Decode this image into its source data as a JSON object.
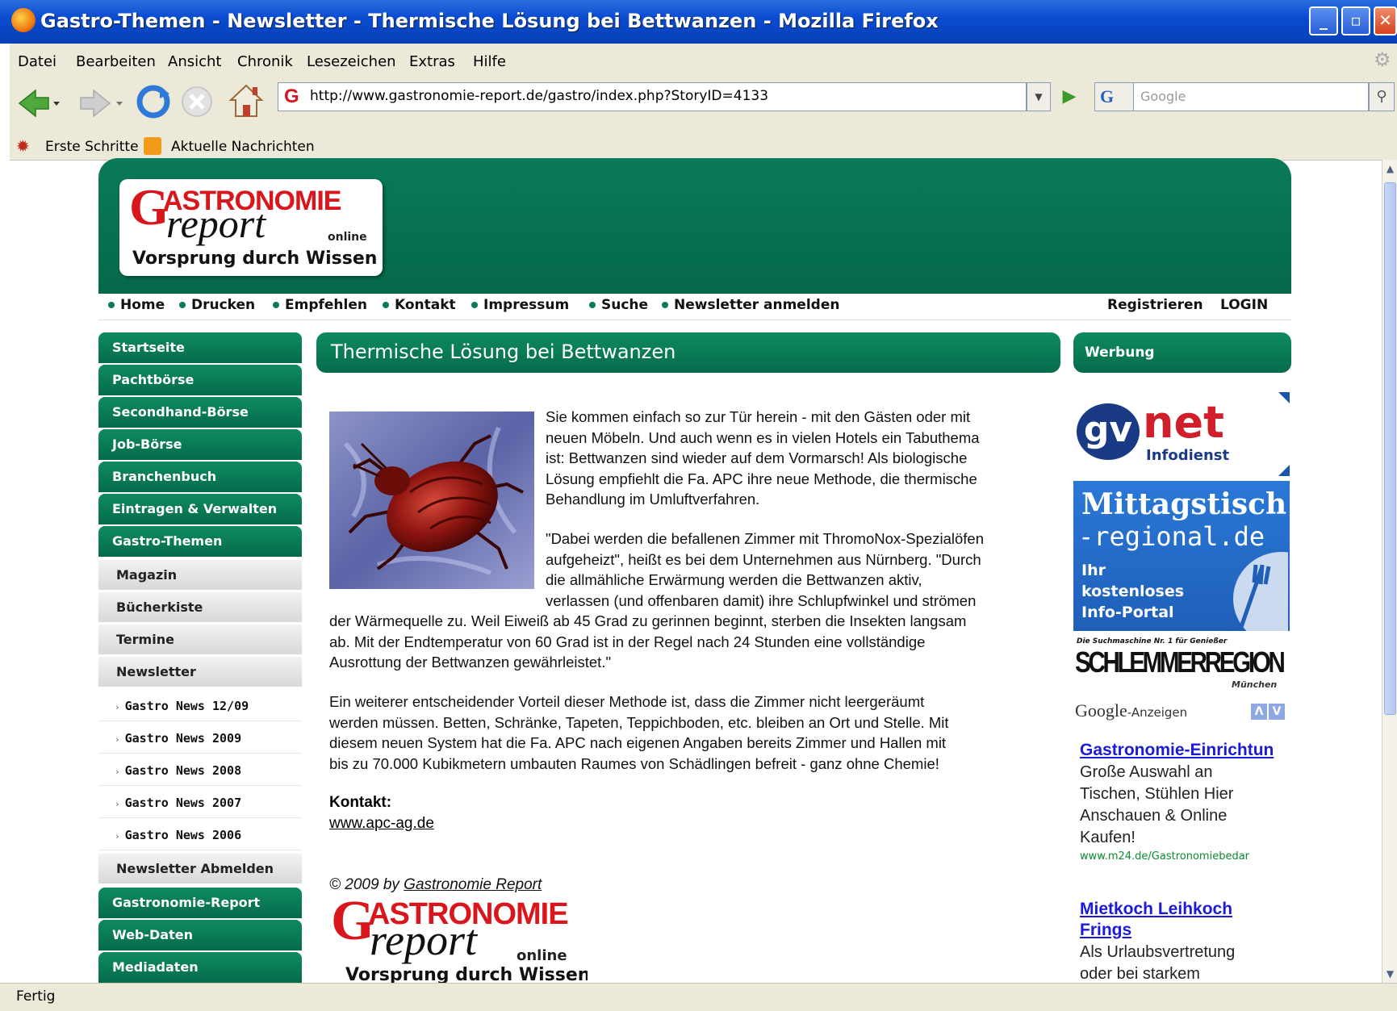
{
  "window": {
    "title": "Gastro-Themen - Newsletter - Thermische Lösung bei Bettwanzen - Mozilla Firefox",
    "buttons": {
      "minimize": "_",
      "maximize": "▫",
      "close": "✕"
    }
  },
  "menu": [
    "Datei",
    "Bearbeiten",
    "Ansicht",
    "Chronik",
    "Lesezeichen",
    "Extras",
    "Hilfe"
  ],
  "toolbar": {
    "url": "http://www.gastronomie-report.de/gastro/index.php?StoryID=4133",
    "search_placeholder": "Google"
  },
  "bookmarks": [
    "Erste Schritte",
    "Aktuelle Nachrichten"
  ],
  "status": "Fertig",
  "site": {
    "logo": {
      "initial": "G",
      "line1": "ASTRONOMIE",
      "line2": "report",
      "online": "online",
      "slogan": "Vorsprung durch Wissen"
    },
    "topnav": [
      "Home",
      "Drucken",
      "Empfehlen",
      "Kontakt",
      "Impressum",
      "Suche",
      "Newsletter anmelden"
    ],
    "topnav_right": [
      "Registrieren",
      "LOGIN"
    ],
    "sidebar": {
      "green_top": [
        "Startseite",
        "Pachtbörse",
        "Secondhand-Börse",
        "Job-Börse",
        "Branchenbuch",
        "Eintragen & Verwalten",
        "Gastro-Themen"
      ],
      "gray": [
        "Magazin",
        "Bücherkiste",
        "Termine",
        "Newsletter"
      ],
      "sub": [
        "Gastro News 12/09",
        "Gastro News 2009",
        "Gastro News 2008",
        "Gastro News 2007",
        "Gastro News 2006"
      ],
      "gray_bottom": "Newsletter Abmelden",
      "green_bottom": [
        "Gastronomie-Report",
        "Web-Daten",
        "Mediadaten"
      ]
    },
    "article": {
      "title": "Thermische Lösung bei Bettwanzen",
      "p1_lines": [
        "Sie kommen einfach so zur Tür herein - mit den Gästen oder mit",
        "neuen Möbeln. Und auch wenn es in vielen Hotels ein Tabuthema",
        "ist: Bettwanzen sind wieder auf dem Vormarsch! Als biologische",
        "Lösung empfiehlt die Fa. APC ihre neue Methode, die thermische",
        "Behandlung im Umluftverfahren."
      ],
      "p2_lines_right": [
        "\"Dabei werden die befallenen Zimmer mit ThromoNox-Spezialöfen",
        "aufgeheizt\", heißt es bei dem Unternehmen aus Nürnberg. \"Durch",
        "die allmähliche Erwärmung werden die Bettwanzen aktiv,",
        "verlassen (und offenbaren damit) ihre Schlupfwinkel und strömen"
      ],
      "p2_lines_full": [
        "der Wärmequelle zu. Weil Eiweiß ab 45 Grad zu gerinnen beginnt, sterben die Insekten langsam",
        "ab. Mit der Endtemperatur von 60 Grad ist in der Regel nach 24 Stunden eine vollständige",
        "Ausrottung der Bettwanzen gewährleistet.\""
      ],
      "p3_lines": [
        "Ein weiterer entscheidender Vorteil dieser Methode ist, dass die Zimmer nicht leergeräumt",
        "werden müssen. Betten, Schränke, Tapeten, Teppichboden, etc. bleiben an Ort und Stelle. Mit",
        "diesem neuen System hat die Fa. APC nach eigenen Angaben bereits Zimmer und Hallen mit",
        "bis zu 70.000 Kubikmetern umbauten Raumes von Schädlingen befreit - ganz ohne Chemie!"
      ],
      "contact_label": "Kontakt:",
      "contact_link": "www.apc-ag.de",
      "copyright_prefix": "© 2009 by ",
      "copyright_link": "Gastronomie Report"
    },
    "right": {
      "title": "Werbung",
      "gvnet": {
        "brand": "gv",
        "net": "net",
        "sub": "Infodienst"
      },
      "mittag": {
        "line1": "Mittagstisch",
        "line2": "-regional.de",
        "desc": [
          "Ihr",
          "kostenloses",
          "Info-Portal"
        ]
      },
      "schlemmer": {
        "top": "Die Suchmaschine Nr. 1 für Genießer",
        "main": "SCHLEMMERREGION",
        "city": "München"
      },
      "google_label": "Google",
      "google_suffix": "-Anzeigen",
      "ads": [
        {
          "title": "Gastronomie-Einrichtun",
          "text": [
            "Große Auswahl an",
            "Tischen, Stühlen Hier",
            "Anschauen & Online",
            "Kaufen!"
          ],
          "url": "www.m24.de/Gastronomiebedar"
        },
        {
          "title_lines": [
            "Mietkoch Leihkoch",
            "Frings"
          ],
          "text": [
            "Als Urlaubsvertretung",
            "oder bei starkem"
          ]
        }
      ]
    }
  },
  "colors": {
    "brand_green": "#0a7a58",
    "logo_red": "#d9161c",
    "titlebar_blue": "#0a4bd0"
  }
}
